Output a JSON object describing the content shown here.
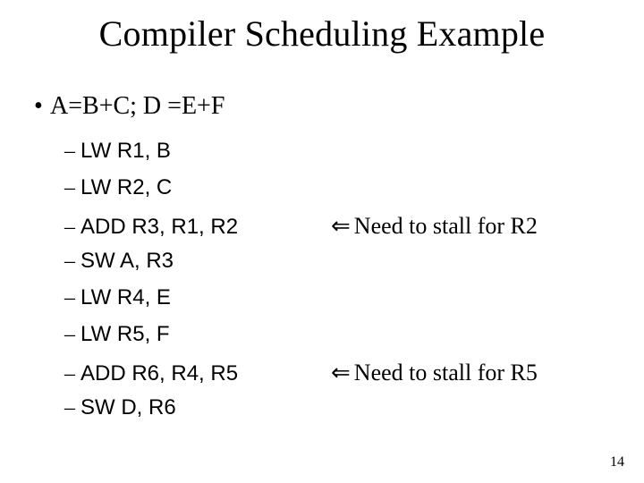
{
  "title": "Compiler Scheduling Example",
  "bullet": "A=B+C;  D =E+F",
  "rows": [
    {
      "instr": "LW R1, B",
      "note": ""
    },
    {
      "instr": "LW R2, C",
      "note": ""
    },
    {
      "instr": "ADD R3, R1, R2",
      "note": "Need to stall for R2"
    },
    {
      "instr": "SW A, R3",
      "note": ""
    },
    {
      "instr": "LW R4, E",
      "note": ""
    },
    {
      "instr": "LW R5, F",
      "note": ""
    },
    {
      "instr": "ADD R6, R4, R5",
      "note": "Need to stall for R5"
    },
    {
      "instr": "SW D, R6",
      "note": ""
    }
  ],
  "arrow_glyph": "⇐",
  "page_number": "14"
}
